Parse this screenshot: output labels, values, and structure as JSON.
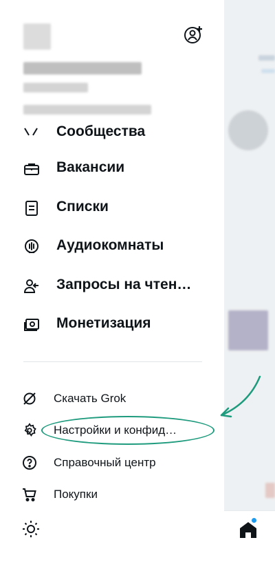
{
  "drawer": {
    "partially_visible_item": {
      "label": "Сообщества",
      "icon": "communities-icon"
    },
    "primary_items": [
      {
        "label": "Вакансии",
        "icon": "briefcase-icon"
      },
      {
        "label": "Списки",
        "icon": "list-icon"
      },
      {
        "label": "Аудиокомнаты",
        "icon": "microphone-icon"
      },
      {
        "label": "Запросы на чтен…",
        "icon": "follow-requests-icon"
      },
      {
        "label": "Монетизация",
        "icon": "monetization-icon"
      }
    ],
    "secondary_items": [
      {
        "label": "Скачать Grok",
        "icon": "grok-icon"
      },
      {
        "label": "Настройки и конфид…",
        "icon": "gear-icon"
      },
      {
        "label": "Справочный центр",
        "icon": "help-icon"
      },
      {
        "label": "Покупки",
        "icon": "cart-icon"
      }
    ],
    "theme_toggle_icon": "sun-icon",
    "add_account_icon": "add-account-icon"
  },
  "annotation": {
    "color": "#1e9b7d",
    "highlighted_item": "Настройки и конфид…"
  },
  "bottom_nav": {
    "home_icon": "home-icon",
    "notification_dot_color": "#1d9bf0"
  },
  "colors": {
    "text": "#0f1419",
    "background": "#ffffff",
    "feed_background": "#eef1f3",
    "divider": "#e1e5e8"
  }
}
